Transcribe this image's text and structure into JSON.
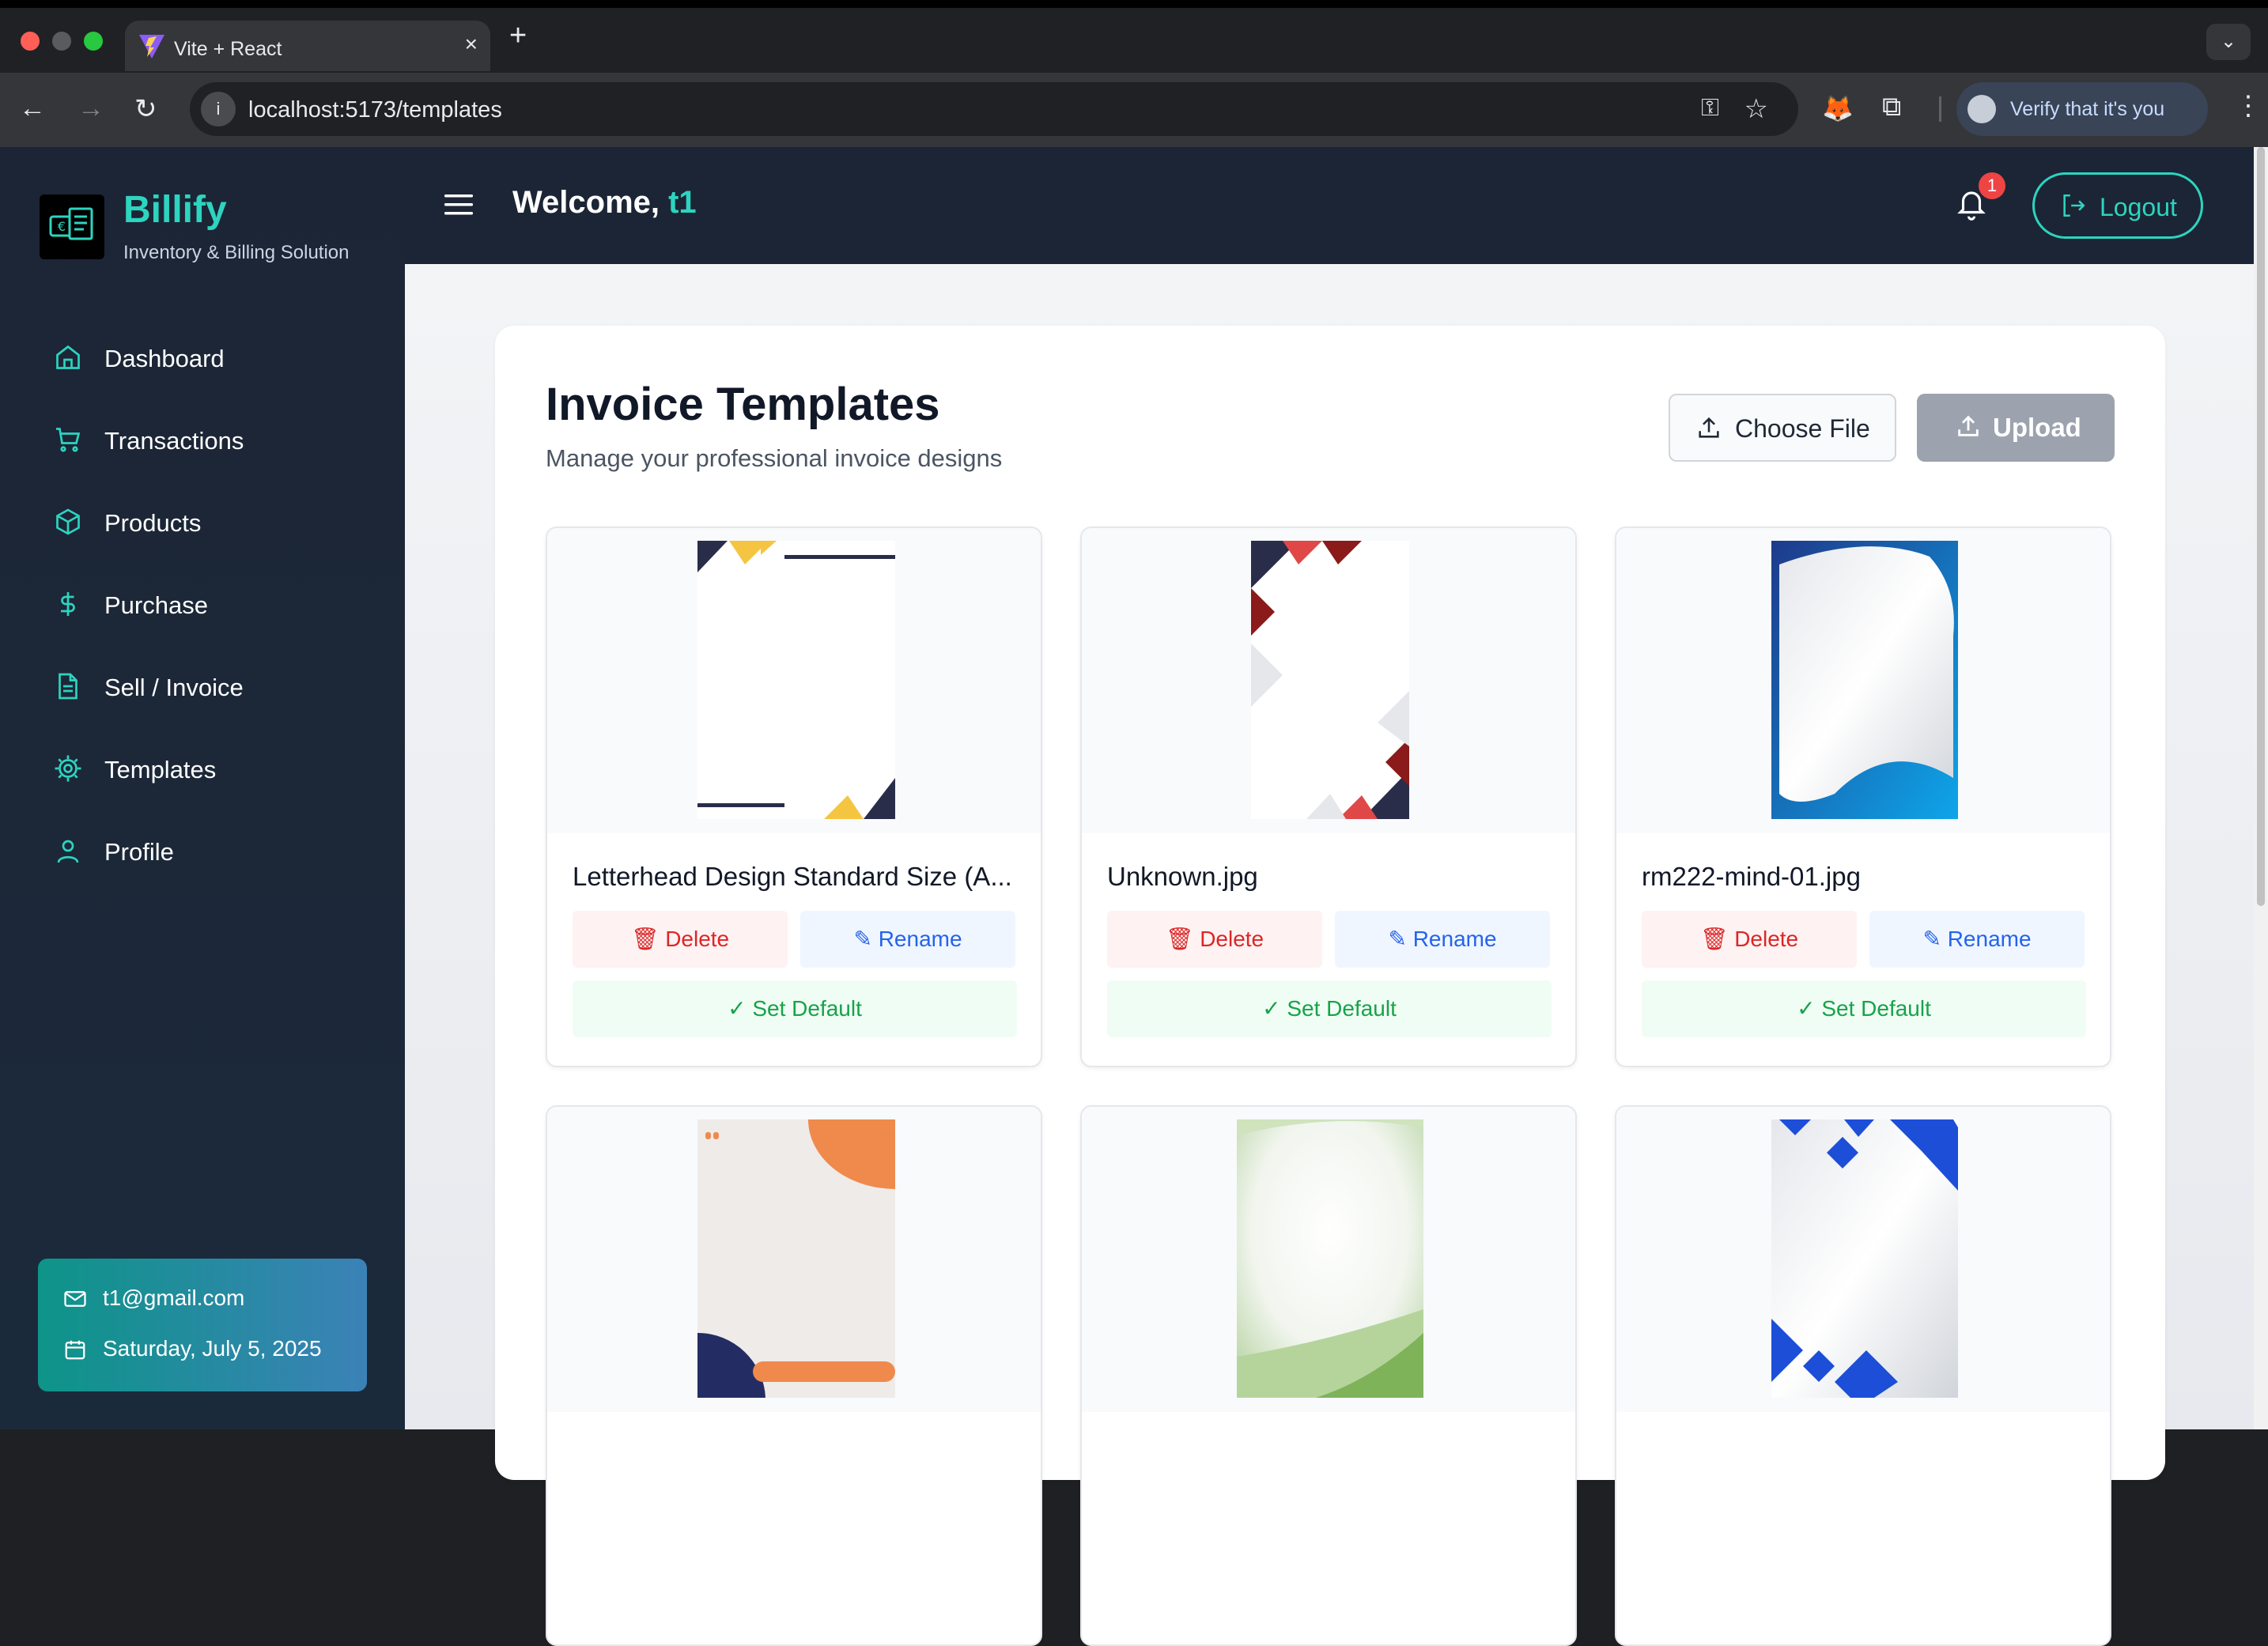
{
  "browser": {
    "tab_title": "Vite + React",
    "tab_close": "×",
    "new_tab": "+",
    "url": "localhost:5173/templates",
    "profile_label": "Verify that it's you"
  },
  "sidebar": {
    "brand": "Billify",
    "brand_sub": "Inventory & Billing Solution",
    "items": [
      {
        "label": "Dashboard",
        "icon": "home-icon"
      },
      {
        "label": "Transactions",
        "icon": "cart-icon"
      },
      {
        "label": "Products",
        "icon": "box-icon"
      },
      {
        "label": "Purchase",
        "icon": "dollar-icon"
      },
      {
        "label": "Sell / Invoice",
        "icon": "document-icon"
      },
      {
        "label": "Templates",
        "icon": "gear-icon"
      },
      {
        "label": "Profile",
        "icon": "user-icon"
      }
    ],
    "user_email": "t1@gmail.com",
    "user_date": "Saturday, July 5, 2025"
  },
  "header": {
    "welcome_prefix": "Welcome, ",
    "username": "t1",
    "notification_count": "1",
    "logout_label": "Logout"
  },
  "page": {
    "title": "Invoice Templates",
    "subtitle": "Manage your professional invoice designs",
    "choose_file_label": "Choose File",
    "upload_label": "Upload"
  },
  "actions": {
    "delete": "Delete",
    "rename": "Rename",
    "set_default": "Set Default"
  },
  "templates": [
    {
      "name": "Letterhead Design Standard Size (A..."
    },
    {
      "name": "Unknown.jpg"
    },
    {
      "name": "rm222-mind-01.jpg"
    },
    {
      "name": ""
    },
    {
      "name": ""
    },
    {
      "name": ""
    }
  ],
  "colors": {
    "accent": "#2dd4bf",
    "sidebar_bg": "#1c2535",
    "danger": "#dc2626",
    "info": "#2563eb",
    "success": "#16a34a",
    "badge": "#ef4444"
  }
}
